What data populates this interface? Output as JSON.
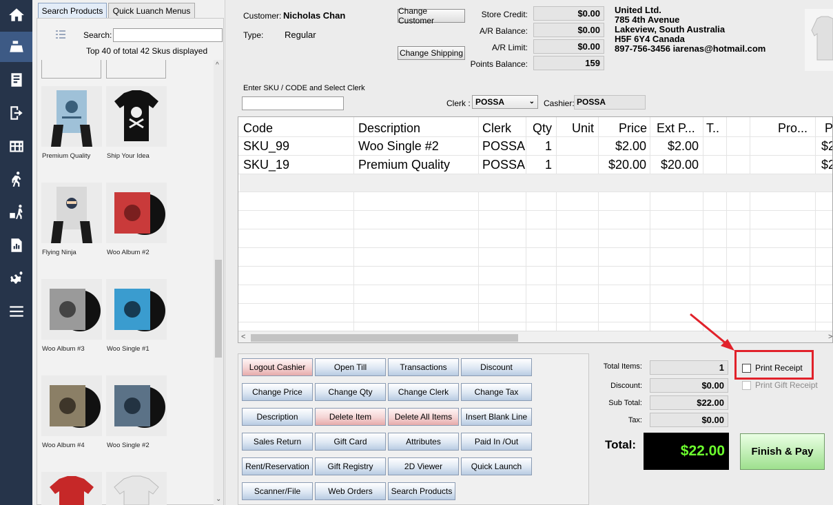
{
  "nav": {
    "items": [
      {
        "icon": "home-icon"
      },
      {
        "icon": "cash-register-icon"
      },
      {
        "icon": "invoice-icon"
      },
      {
        "icon": "exit-icon"
      },
      {
        "icon": "warehouse-icon"
      },
      {
        "icon": "runner-icon"
      },
      {
        "icon": "delivery-icon"
      },
      {
        "icon": "report-icon"
      },
      {
        "icon": "settings-icon"
      },
      {
        "icon": "menu-icon"
      }
    ]
  },
  "products": {
    "tabs": [
      "Search Products",
      "Quick Luanch Menus"
    ],
    "search_label": "Search:",
    "search_value": "",
    "count_text": "Top 40 of total 42 Skus displayed",
    "items": [
      {
        "name": "Premium Quality"
      },
      {
        "name": "Ship Your Idea"
      },
      {
        "name": "Flying Ninja"
      },
      {
        "name": "Woo Album #2"
      },
      {
        "name": "Woo Album #3"
      },
      {
        "name": "Woo Single #1"
      },
      {
        "name": "Woo Album #4"
      },
      {
        "name": "Woo Single #2"
      }
    ]
  },
  "customer": {
    "customer_label": "Customer:",
    "customer_name": "Nicholas Chan",
    "type_label": "Type:",
    "type_value": "Regular",
    "change_customer": "Change Customer",
    "change_shipping": "Change Shipping"
  },
  "balances": {
    "store_credit_label": "Store Credit:",
    "store_credit": "$0.00",
    "ar_balance_label": "A/R Balance:",
    "ar_balance": "$0.00",
    "ar_limit_label": "A/R Limit:",
    "ar_limit": "$0.00",
    "points_label": "Points Balance:",
    "points": "159"
  },
  "address": {
    "lines": [
      "United Ltd.",
      "785 4th Avenue",
      "Lakeview, South Australia",
      "H5F 6Y4 Canada",
      "897-756-3456 iarenas@hotmail.com"
    ]
  },
  "entry": {
    "sku_label": "Enter SKU / CODE and Select Clerk",
    "sku_value": "",
    "clerk_label": "Clerk :",
    "clerk_value": "POSSA",
    "cashier_label": "Cashier:",
    "cashier_value": "POSSA"
  },
  "grid": {
    "columns": [
      "Code",
      "Description",
      "Clerk",
      "Qty",
      "Unit",
      "Price",
      "Ext P...",
      "T..",
      "",
      "",
      "Pro...",
      "P"
    ],
    "rows": [
      {
        "code": "SKU_99",
        "description": "Woo Single #2",
        "clerk": "POSSA",
        "qty": "1",
        "unit": "",
        "price": "$2.00",
        "ext": "$2.00",
        "extra": "$2"
      },
      {
        "code": "SKU_19",
        "description": "Premium Quality",
        "clerk": "POSSA",
        "qty": "1",
        "unit": "",
        "price": "$20.00",
        "ext": "$20.00",
        "extra": "$2"
      }
    ]
  },
  "actions": {
    "buttons": [
      {
        "label": "Logout Cashier",
        "style": "red"
      },
      {
        "label": "Open Till",
        "style": "blue"
      },
      {
        "label": "Transactions",
        "style": "blue"
      },
      {
        "label": "Discount",
        "style": "blue"
      },
      {
        "label": "Change Price",
        "style": "blue"
      },
      {
        "label": "Change Qty",
        "style": "blue"
      },
      {
        "label": "Change Clerk",
        "style": "blue"
      },
      {
        "label": "Change Tax",
        "style": "blue"
      },
      {
        "label": "Description",
        "style": "blue"
      },
      {
        "label": "Delete Item",
        "style": "red"
      },
      {
        "label": "Delete All Items",
        "style": "red"
      },
      {
        "label": "Insert Blank Line",
        "style": "blue"
      },
      {
        "label": "Sales Return",
        "style": "blue"
      },
      {
        "label": "Gift Card",
        "style": "blue"
      },
      {
        "label": "Attributes",
        "style": "blue"
      },
      {
        "label": "Paid In /Out",
        "style": "blue"
      },
      {
        "label": "Rent/Reservation",
        "style": "blue"
      },
      {
        "label": "Gift Registry",
        "style": "blue"
      },
      {
        "label": "2D Viewer",
        "style": "blue"
      },
      {
        "label": "Quick Launch",
        "style": "blue"
      },
      {
        "label": "Scanner/File",
        "style": "blue"
      },
      {
        "label": "Web Orders",
        "style": "blue"
      },
      {
        "label": "Search Products",
        "style": "blue"
      }
    ]
  },
  "totals": {
    "total_items_label": "Total Items:",
    "total_items": "1",
    "discount_label": "Discount:",
    "discount": "$0.00",
    "subtotal_label": "Sub Total:",
    "subtotal": "$22.00",
    "tax_label": "Tax:",
    "tax": "$0.00",
    "total_label": "Total:",
    "total": "$22.00",
    "finish_label": "Finish & Pay",
    "print_receipt": "Print Receipt",
    "print_gift_receipt": "Print Gift Receipt"
  },
  "colors": {
    "nav_bg": "#26344a",
    "highlight": "#e1212a",
    "total_text": "#6cff2e"
  }
}
